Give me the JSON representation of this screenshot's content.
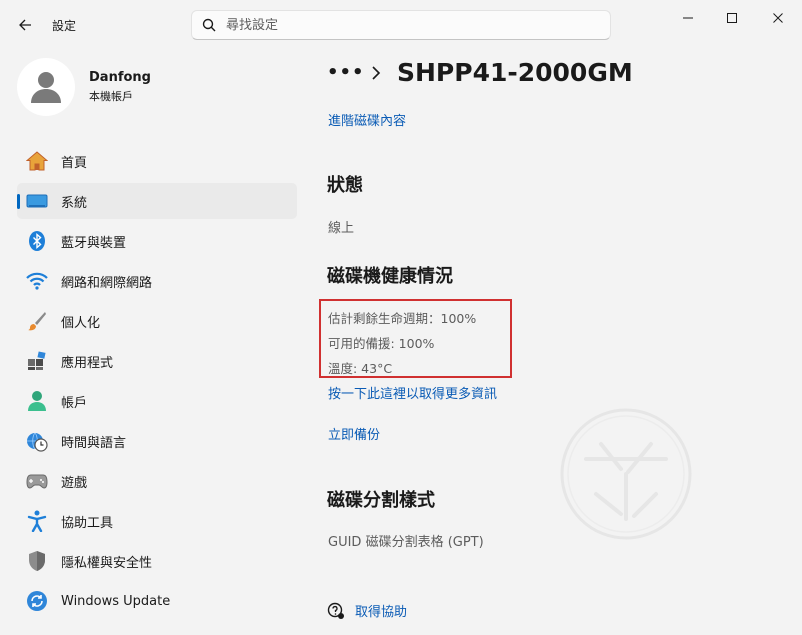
{
  "window": {
    "app_title": "設定",
    "search": {
      "placeholder": "尋找設定"
    }
  },
  "profile": {
    "name": "Danfong",
    "account_type": "本機帳戶"
  },
  "sidebar": {
    "items": [
      {
        "label": "首頁",
        "icon": "home-icon"
      },
      {
        "label": "系統",
        "icon": "system-icon",
        "active": true
      },
      {
        "label": "藍牙與裝置",
        "icon": "bluetooth-icon"
      },
      {
        "label": "網路和網際網路",
        "icon": "wifi-icon"
      },
      {
        "label": "個人化",
        "icon": "brush-icon"
      },
      {
        "label": "應用程式",
        "icon": "apps-icon"
      },
      {
        "label": "帳戶",
        "icon": "account-icon"
      },
      {
        "label": "時間與語言",
        "icon": "clock-globe-icon"
      },
      {
        "label": "遊戲",
        "icon": "gamepad-icon"
      },
      {
        "label": "協助工具",
        "icon": "accessibility-icon"
      },
      {
        "label": "隱私權與安全性",
        "icon": "shield-icon"
      },
      {
        "label": "Windows Update",
        "icon": "update-icon"
      }
    ]
  },
  "content": {
    "breadcrumb_more": "•••",
    "title": "SHPP41-2000GM",
    "advanced_link": "進階磁碟內容",
    "status": {
      "heading": "狀態",
      "value": "線上"
    },
    "health": {
      "heading": "磁碟機健康情況",
      "life_remaining": "估計剩餘生命週期：100%",
      "spare": "可用的備援: 100%",
      "temperature": "溫度: 43°C",
      "more_info_link": "按一下此這裡以取得更多資訊",
      "backup_link": "立即備份"
    },
    "partition": {
      "heading": "磁碟分割樣式",
      "value": "GUID 磁碟分割表格 (GPT)"
    },
    "help_label": "取得協助"
  },
  "colors": {
    "accent": "#0067c0",
    "link": "#0a5bb5",
    "highlight_border": "#d03030"
  }
}
